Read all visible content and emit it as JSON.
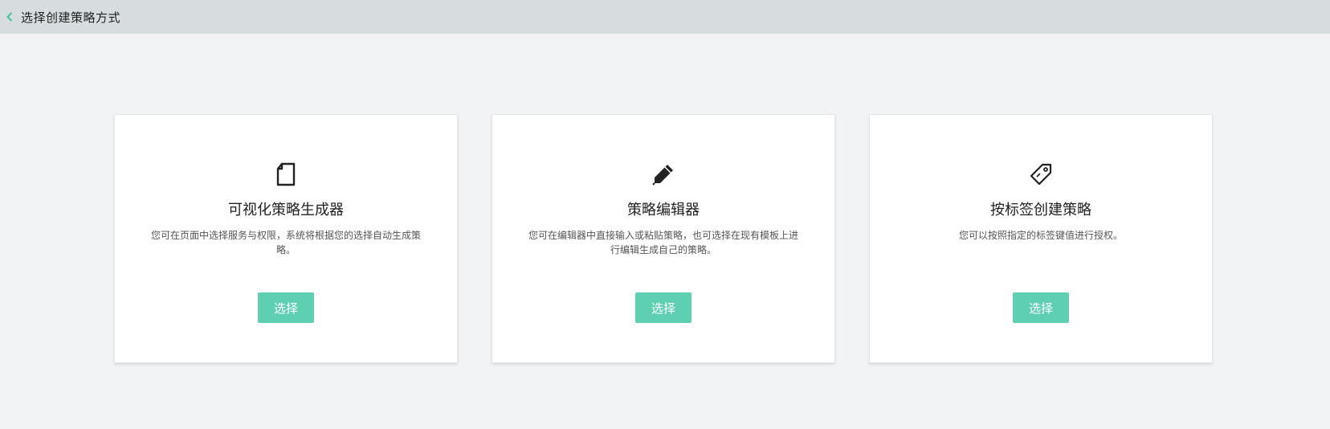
{
  "header": {
    "title": "选择创建策略方式",
    "back_icon": "chevron-left-icon",
    "accent": "#3ec4a0"
  },
  "cards": [
    {
      "icon": "document-icon",
      "title": "可视化策略生成器",
      "description": "您可在页面中选择服务与权限，系统将根据您的选择自动生成策略。",
      "button_label": "选择"
    },
    {
      "icon": "pencil-icon",
      "title": "策略编辑器",
      "description": "您可在编辑器中直接输入或粘贴策略，也可选择在现有模板上进行编辑生成自己的策略。",
      "button_label": "选择"
    },
    {
      "icon": "tag-icon",
      "title": "按标签创建策略",
      "description": "您可以按照指定的标签键值进行授权。",
      "button_label": "选择"
    }
  ],
  "colors": {
    "header_bg": "#d7dcdf",
    "page_bg": "#f2f3f5",
    "button_bg": "#5fcfb2",
    "button_text": "#ffffff"
  }
}
